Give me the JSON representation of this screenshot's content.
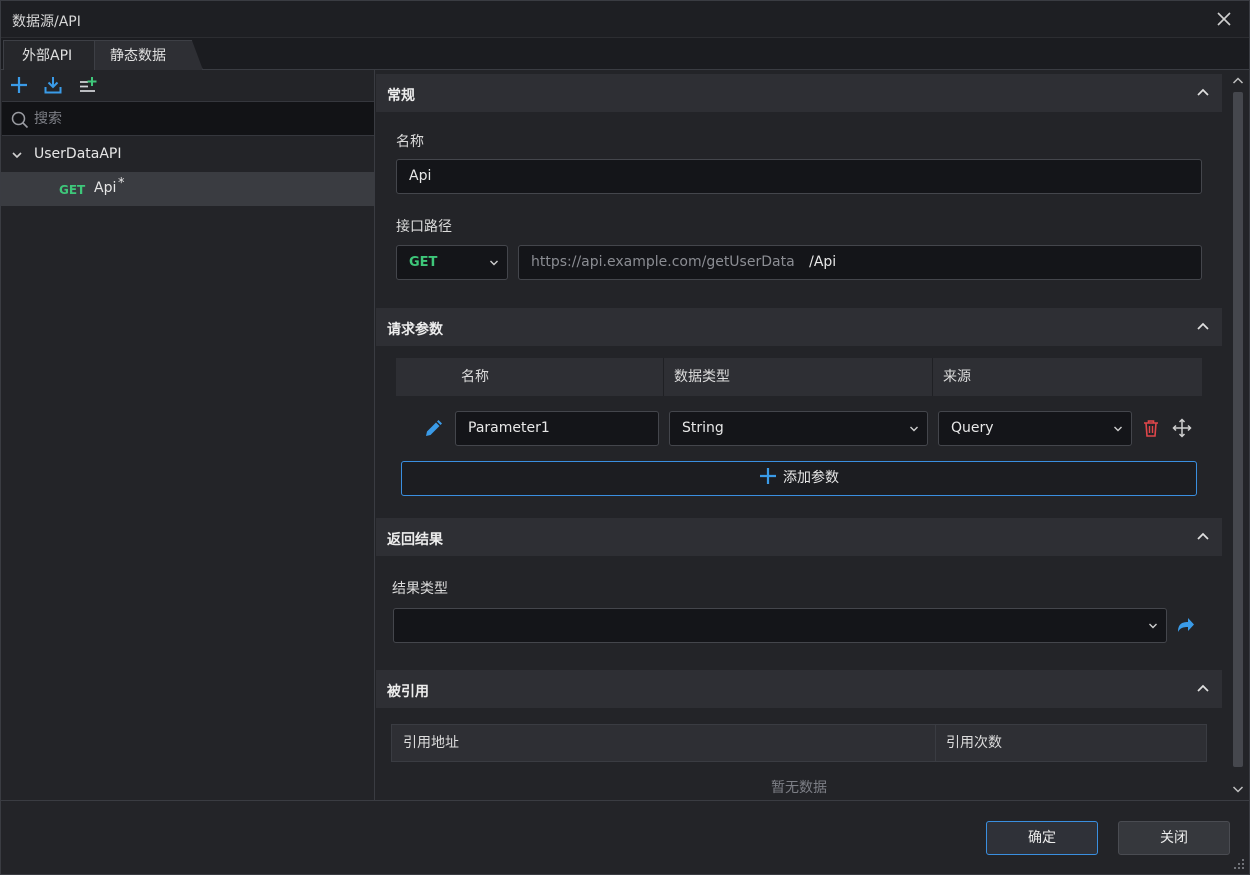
{
  "window": {
    "title": "数据源/API",
    "close_icon": "close-icon"
  },
  "tabs": [
    {
      "label": "外部API",
      "active": true
    },
    {
      "label": "静态数据",
      "active": false
    }
  ],
  "left": {
    "toolbar": {
      "add_icon": "plus-icon",
      "import_icon": "download-icon",
      "add_list_icon": "list-add-icon",
      "accent": "#3a9be8"
    },
    "search": {
      "placeholder": "搜索",
      "value": ""
    },
    "tree": {
      "group": {
        "label": "UserDataAPI",
        "expanded": true
      },
      "items": [
        {
          "method": "GET",
          "label": "Api",
          "modified_mark": "*",
          "selected": true
        }
      ]
    }
  },
  "right": {
    "general": {
      "header": "常规",
      "name_label": "名称",
      "name_value": "Api",
      "path_label": "接口路径",
      "method_value": "GET",
      "base_url": "https://api.example.com/getUserData",
      "path_value": "/Api"
    },
    "params": {
      "header": "请求参数",
      "columns": [
        "名称",
        "数据类型",
        "来源"
      ],
      "rows": [
        {
          "name": "Parameter1",
          "type": "String",
          "source": "Query"
        }
      ],
      "add_label": "添加参数"
    },
    "result": {
      "header": "返回结果",
      "type_label": "结果类型",
      "type_value": ""
    },
    "refs": {
      "header": "被引用",
      "columns": [
        "引用地址",
        "引用次数"
      ],
      "empty": "暂无数据"
    }
  },
  "footer": {
    "ok_label": "确定",
    "close_label": "关闭"
  },
  "colors": {
    "get_method": "#3ec77a",
    "accent_blue": "#3a8fe0",
    "delete_red": "#e0464a",
    "background": "#232428"
  }
}
